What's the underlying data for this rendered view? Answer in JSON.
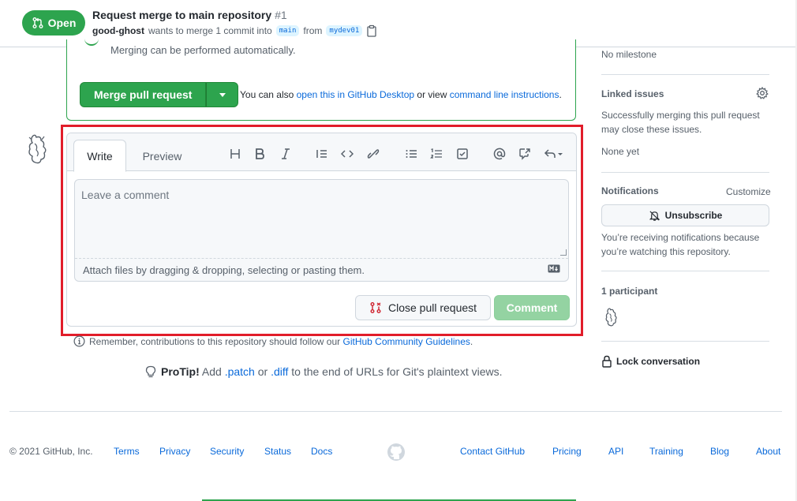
{
  "header": {
    "state_label": "Open",
    "title": "Request merge to main repository",
    "number": "#1",
    "author": "good-ghost",
    "meta_text": "wants to merge 1 commit into",
    "base_branch": "main",
    "from_text": "from",
    "head_branch": "mydev01"
  },
  "merge": {
    "status_text": "Merging can be performed automatically.",
    "button_label": "Merge pull request",
    "alt_prefix": "You can also",
    "alt_link_1": "open this in GitHub Desktop",
    "alt_middle": "or view",
    "alt_link_2": "command line instructions",
    "alt_suffix": "."
  },
  "comment": {
    "tab_write": "Write",
    "tab_preview": "Preview",
    "placeholder": "Leave a comment",
    "attach_text": "Attach files by dragging & dropping, selecting or pasting them.",
    "close_button": "Close pull request",
    "comment_button": "Comment"
  },
  "guidelines": {
    "text": "Remember, contributions to this repository should follow our",
    "link": "GitHub Community Guidelines",
    "suffix": "."
  },
  "protip": {
    "label": "ProTip!",
    "pre": "Add",
    "patch": ".patch",
    "or": "or",
    "diff": ".diff",
    "post": "to the end of URLs for Git's plaintext views."
  },
  "sidebar": {
    "milestone": "No milestone",
    "linked_issues_heading": "Linked issues",
    "linked_issues_text_1": "Successfully merging this pull request",
    "linked_issues_text_2": "may close these issues.",
    "linked_issues_none": "None yet",
    "notifications_heading": "Notifications",
    "customize": "Customize",
    "unsubscribe": "Unsubscribe",
    "notif_text_1": "You’re receiving notifications because",
    "notif_text_2": "you’re watching this repository.",
    "participants": "1 participant",
    "lock": "Lock conversation"
  },
  "footer": {
    "copyright": "© 2021 GitHub, Inc.",
    "terms": "Terms",
    "privacy": "Privacy",
    "security": "Security",
    "status": "Status",
    "docs": "Docs",
    "contact": "Contact GitHub",
    "pricing": "Pricing",
    "api": "API",
    "training": "Training",
    "blog": "Blog",
    "about": "About"
  },
  "colors": {
    "accent_green": "#2da44e",
    "link_blue": "#0969da",
    "highlight_red": "#e11d2a",
    "disabled_green": "#94d3a2"
  },
  "icons": [
    "git-pull-request-icon",
    "clipboard-icon",
    "heading-icon",
    "bold-icon",
    "italic-icon",
    "quote-icon",
    "code-icon",
    "link-icon",
    "unordered-list-icon",
    "ordered-list-icon",
    "task-list-icon",
    "mention-icon",
    "cross-reference-icon",
    "reply-icon",
    "markdown-icon",
    "gear-icon",
    "bell-slash-icon",
    "lock-icon",
    "info-icon",
    "light-bulb-icon",
    "github-mark-icon"
  ]
}
